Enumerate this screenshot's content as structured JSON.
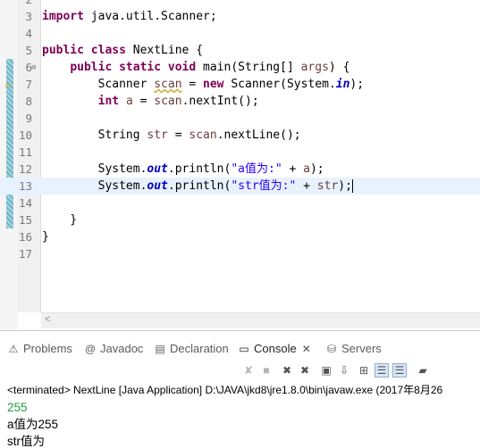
{
  "editor": {
    "lines": [
      {
        "num": "2",
        "code": []
      },
      {
        "num": "3",
        "code": [
          [
            "kw",
            "import"
          ],
          [
            "",
            " java.util.Scanner;"
          ]
        ]
      },
      {
        "num": "4",
        "code": []
      },
      {
        "num": "5",
        "code": [
          [
            "kw",
            "public class"
          ],
          [
            "",
            " NextLine {"
          ]
        ]
      },
      {
        "num": "6",
        "code": [
          [
            "",
            "    "
          ],
          [
            "kw",
            "public static void"
          ],
          [
            "",
            " main(String[] "
          ],
          [
            "var",
            "args"
          ],
          [
            "",
            ") {"
          ]
        ],
        "fold": "⊖"
      },
      {
        "num": "7",
        "code": [
          [
            "",
            "        Scanner "
          ],
          [
            "warn",
            "scan"
          ],
          [
            "",
            " = "
          ],
          [
            "kw",
            "new"
          ],
          [
            "",
            " Scanner(System."
          ],
          [
            "fld",
            "in"
          ],
          [
            "",
            ");"
          ]
        ],
        "warn": "⚠"
      },
      {
        "num": "8",
        "code": [
          [
            "",
            "        "
          ],
          [
            "kw",
            "int"
          ],
          [
            "",
            " "
          ],
          [
            "var",
            "a"
          ],
          [
            "",
            " = "
          ],
          [
            "var",
            "scan"
          ],
          [
            "",
            ".nextInt();"
          ]
        ]
      },
      {
        "num": "9",
        "code": []
      },
      {
        "num": "10",
        "code": [
          [
            "",
            "        String "
          ],
          [
            "var",
            "str"
          ],
          [
            "",
            " = "
          ],
          [
            "var",
            "scan"
          ],
          [
            "",
            ".nextLine();"
          ]
        ]
      },
      {
        "num": "11",
        "code": []
      },
      {
        "num": "12",
        "code": [
          [
            "",
            "        System."
          ],
          [
            "fld",
            "out"
          ],
          [
            "",
            ".println("
          ],
          [
            "str",
            "\"a值为:\""
          ],
          [
            "",
            " + "
          ],
          [
            "var",
            "a"
          ],
          [
            "",
            ");"
          ]
        ]
      },
      {
        "num": "13",
        "code": [
          [
            "",
            "        System."
          ],
          [
            "fld",
            "out"
          ],
          [
            "",
            ".println("
          ],
          [
            "str",
            "\"str值为:\""
          ],
          [
            "",
            " + "
          ],
          [
            "var",
            "str"
          ],
          [
            "",
            ");"
          ]
        ],
        "current": true
      },
      {
        "num": "14",
        "code": []
      },
      {
        "num": "15",
        "code": [
          [
            "",
            "    }"
          ]
        ]
      },
      {
        "num": "16",
        "code": [
          [
            "",
            "}"
          ]
        ]
      },
      {
        "num": "17",
        "code": []
      }
    ],
    "scroll_left_glyph": "<"
  },
  "views": {
    "tabs": [
      {
        "label": "Problems",
        "icon": "⚠",
        "icon_name": "problems-icon"
      },
      {
        "label": "Javadoc",
        "icon": "@",
        "icon_name": "javadoc-icon"
      },
      {
        "label": "Declaration",
        "icon": "▤",
        "icon_name": "declaration-icon"
      },
      {
        "label": "Console",
        "icon": "▭",
        "icon_name": "console-icon",
        "active": true,
        "close": "✕"
      },
      {
        "label": "Servers",
        "icon": "⛁",
        "icon_name": "servers-icon"
      }
    ],
    "toolbar": [
      {
        "glyph": "✘",
        "name": "terminate-icon",
        "disabled": true
      },
      {
        "glyph": "■",
        "name": "stop-icon",
        "disabled": true
      },
      {
        "glyph": "✖",
        "name": "remove-launch-icon"
      },
      {
        "glyph": "✖",
        "name": "remove-all-terminated-icon"
      },
      {
        "glyph": "▣",
        "name": "clear-console-icon"
      },
      {
        "glyph": "⇩",
        "name": "scroll-lock-icon"
      },
      {
        "glyph": "⊞",
        "name": "word-wrap-icon"
      },
      {
        "glyph": "☰",
        "name": "show-on-stdout-icon",
        "pressed": true
      },
      {
        "glyph": "☰",
        "name": "show-on-stderr-icon",
        "pressed": true
      },
      {
        "glyph": "▰",
        "name": "pin-console-icon"
      }
    ],
    "status": "<terminated> NextLine [Java Application] D:\\JAVA\\jkd8\\jre1.8.0\\bin\\javaw.exe (2017年8月26",
    "output": [
      {
        "text": "255",
        "kind": "input"
      },
      {
        "text": "a值为255",
        "kind": "plain"
      },
      {
        "text": "str值为",
        "kind": "plain"
      }
    ]
  },
  "colors": {
    "keyword": "#7f0055",
    "string": "#2a00ff",
    "field": "#0000c0",
    "console_input": "#1f9e3a"
  }
}
